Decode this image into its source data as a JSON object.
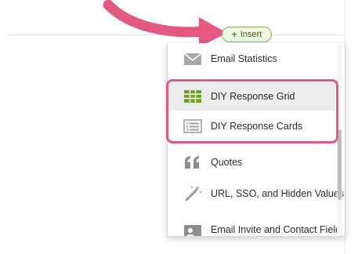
{
  "insert_button": {
    "icon": "plus-icon",
    "label": "Insert"
  },
  "menu": {
    "items": [
      {
        "label": "Email Statistics",
        "icon": "envelope-icon"
      },
      {
        "label": "DIY Response Grid",
        "icon": "grid-table-icon"
      },
      {
        "label": "DIY Response Cards",
        "icon": "list-cards-icon"
      },
      {
        "label": "Quotes",
        "icon": "quote-icon"
      },
      {
        "label": "URL, SSO, and Hidden Values",
        "icon": "magic-wand-icon"
      },
      {
        "label": "Email Invite and Contact Field",
        "icon": "contact-card-icon"
      }
    ]
  },
  "colors": {
    "annotation_pink": "#e5587f",
    "insert_green": "#8ab04f",
    "grid_green": "#6aa121",
    "icon_gray": "#9a9a9a",
    "highlight_bg": "#ececec"
  }
}
